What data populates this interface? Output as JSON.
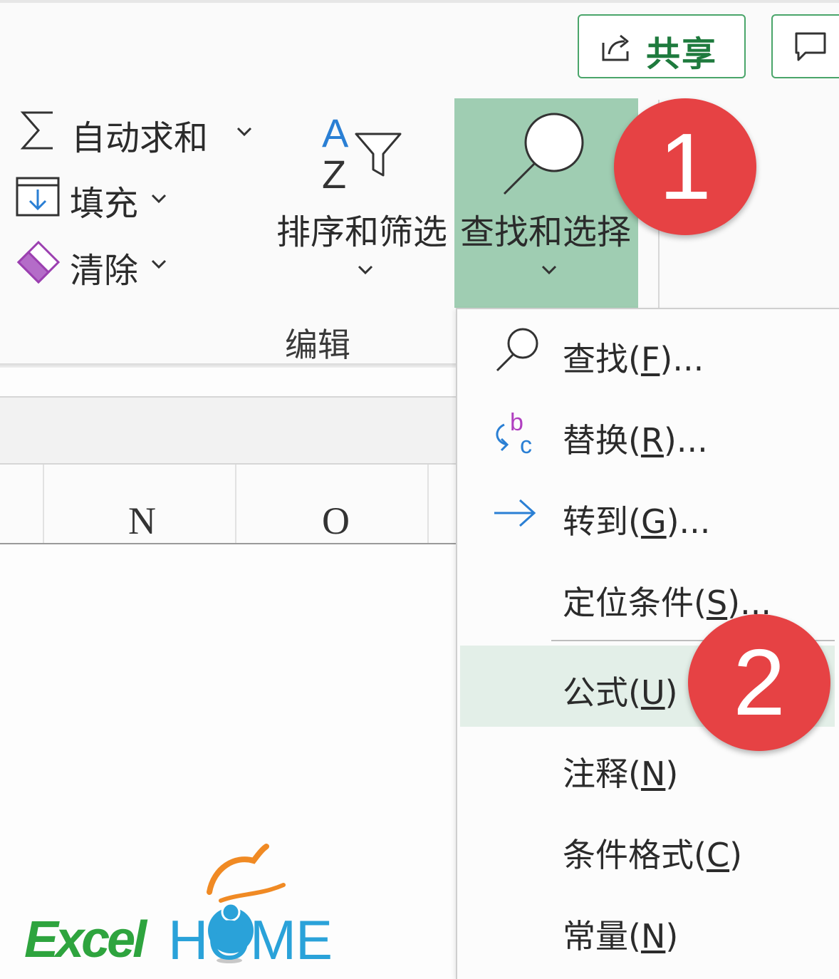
{
  "ribbon": {
    "share_label": "共享",
    "autosum_label": "自动求和",
    "fill_label": "填充",
    "clear_label": "清除",
    "sort_filter_label": "排序和筛选",
    "find_select_label": "查找和选择",
    "group_label": "编辑",
    "highlight_color": "#9fcdb2"
  },
  "sheet": {
    "columns": [
      "N",
      "O"
    ]
  },
  "menu": {
    "items": [
      {
        "label_pre": "查找(",
        "accel": "F",
        "label_post": ")...",
        "icon": "magnifier-icon"
      },
      {
        "label_pre": "替换(",
        "accel": "R",
        "label_post": ")...",
        "icon": "replace-icon"
      },
      {
        "label_pre": "转到(",
        "accel": "G",
        "label_post": ")...",
        "icon": "arrow-right-icon"
      },
      {
        "label_pre": "定位条件(",
        "accel": "S",
        "label_post": ")..."
      },
      {
        "label_pre": "公式(",
        "accel": "U",
        "label_post": ")"
      },
      {
        "label_pre": "注释(",
        "accel": "N",
        "label_post": ")"
      },
      {
        "label_pre": "条件格式(",
        "accel": "C",
        "label_post": ")"
      },
      {
        "label_pre": "常量(",
        "accel": "N",
        "label_post": ")"
      }
    ],
    "selected_index": 4
  },
  "badges": {
    "step1": "1",
    "step2": "2",
    "color": "#e64244"
  },
  "logo": {
    "excel": "Excel",
    "home": "HOME"
  }
}
